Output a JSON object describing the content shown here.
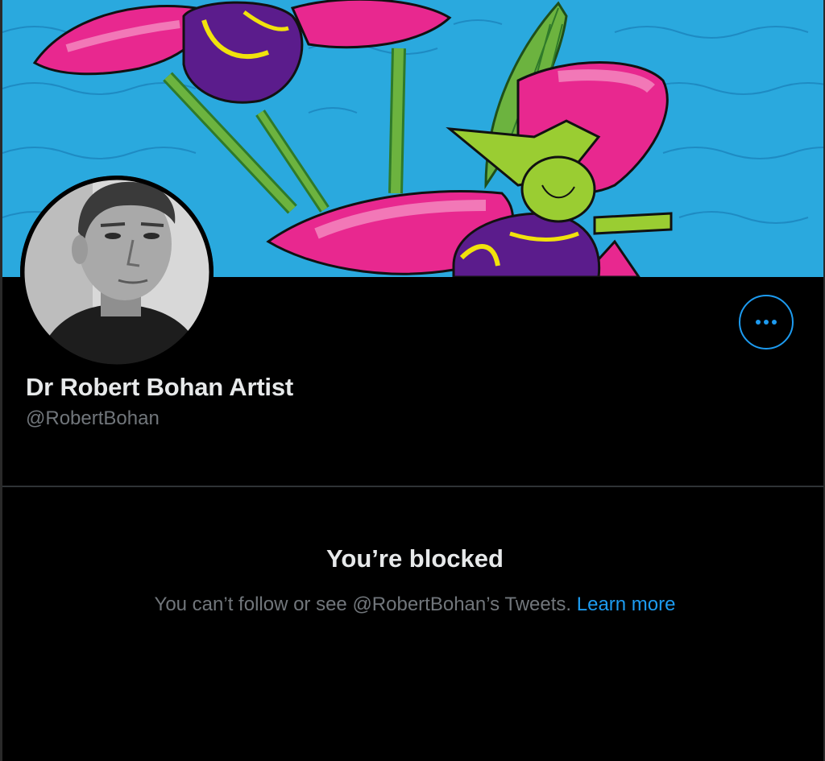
{
  "profile": {
    "display_name": "Dr Robert Bohan Artist",
    "handle": "@RobertBohan"
  },
  "actions": {
    "more_icon": "more-horizontal-icon"
  },
  "blocked": {
    "title": "You’re blocked",
    "message": "You can’t follow or see @RobertBohan’s Tweets.",
    "link_label": "Learn more"
  },
  "colors": {
    "background": "#000000",
    "accent": "#1d9bf0",
    "primary_text": "#e7e9ea",
    "secondary_text": "#71767b",
    "divider": "#2f3336",
    "banner_sky": "#2aa9de",
    "banner_petal": "#e8288f",
    "banner_leaf": "#6cb33f"
  }
}
